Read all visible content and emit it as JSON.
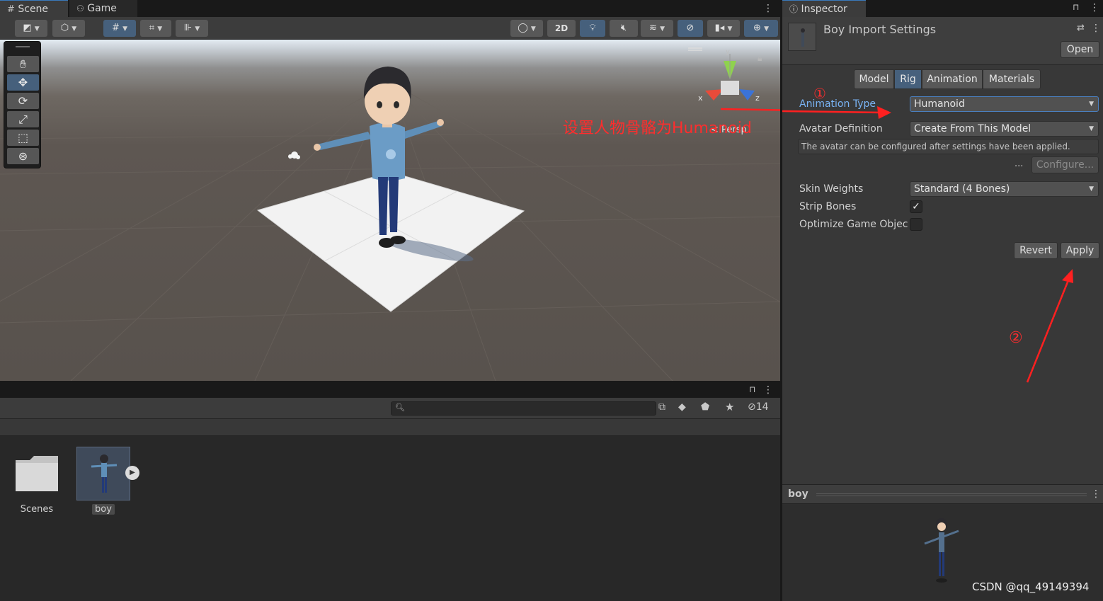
{
  "scene": {
    "tabs": [
      {
        "label": "Scene",
        "icon": "grid-icon",
        "active": true
      },
      {
        "label": "Game",
        "icon": "gamepad-icon",
        "active": false
      }
    ],
    "toolbar": {
      "mode_2d_label": "2D"
    },
    "tools": [
      "hand-tool",
      "move-tool",
      "rotate-tool",
      "scale-tool",
      "rect-tool",
      "transform-tool"
    ],
    "gizmo": {
      "axis_y": "y",
      "axis_x": "x",
      "axis_z": "z",
      "projection_label": "< Persp"
    },
    "annotation": {
      "text": "设置人物骨骼为Humanoid",
      "marker_1": "①",
      "marker_2": "②",
      "color": "#ff2d2d"
    }
  },
  "project": {
    "hidden_count": "14",
    "assets": [
      {
        "label": "Scenes",
        "icon": "folder-icon"
      },
      {
        "label": "boy",
        "icon": "model-prefab-icon"
      }
    ]
  },
  "inspector": {
    "tab_label": "Inspector",
    "title": "Boy Import Settings",
    "open_label": "Open",
    "tabs": [
      {
        "label": "Model",
        "active": false
      },
      {
        "label": "Rig",
        "active": true
      },
      {
        "label": "Animation",
        "active": false
      },
      {
        "label": "Materials",
        "active": false
      }
    ],
    "fields": {
      "animation_type_label": "Animation Type",
      "animation_type_value": "Humanoid",
      "avatar_definition_label": "Avatar Definition",
      "avatar_definition_value": "Create From This Model",
      "help_text": "The avatar can be configured after settings have been applied.",
      "ellipsis": "...",
      "configure_label": "Configure...",
      "skin_weights_label": "Skin Weights",
      "skin_weights_value": "Standard (4 Bones)",
      "strip_bones_label": "Strip Bones",
      "strip_bones_checked": true,
      "optimize_label": "Optimize Game Objec",
      "optimize_checked": false
    },
    "revert_label": "Revert",
    "apply_label": "Apply",
    "preview_title": "boy",
    "watermark": "CSDN @qq_49149394",
    "accent": "#46607c",
    "label_highlight": "#7ab4f5"
  }
}
